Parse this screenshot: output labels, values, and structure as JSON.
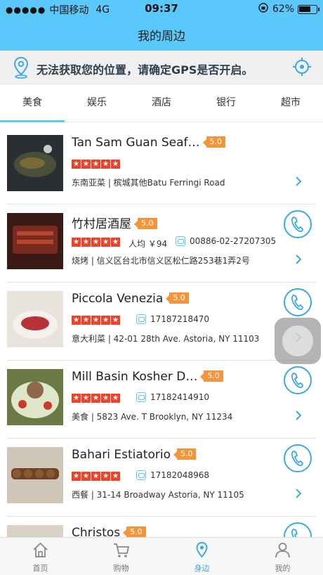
{
  "status": {
    "carrier": "中国移动",
    "network": "4G",
    "time": "09:37",
    "battery": "62%"
  },
  "nav": {
    "title": "我的周边"
  },
  "gps_banner": {
    "message": "无法获取您的位置，请确定GPS是否开启。"
  },
  "categories": [
    {
      "label": "美食",
      "active": true
    },
    {
      "label": "娱乐"
    },
    {
      "label": "酒店"
    },
    {
      "label": "银行"
    },
    {
      "label": "超市"
    }
  ],
  "places": [
    {
      "name": "Tan Sam Guan Seaf…",
      "rating": "5.0",
      "avg_price": "",
      "phone": "",
      "address": "东南亚菜 | 槟城其他Batu Ferringi Road"
    },
    {
      "name": "竹村居酒屋",
      "rating": "5.0",
      "avg_price": "人均 ￥94",
      "phone": "00886-02-27207305",
      "address": "烧烤 | 信义区台北市信义区松仁路253巷1弄2号"
    },
    {
      "name": "Piccola Venezia",
      "rating": "5.0",
      "avg_price": "",
      "phone": "17187218470",
      "address": "意大利菜 | 42-01 28th Ave. Astoria, NY 11103"
    },
    {
      "name": "Mill Basin Kosher D…",
      "rating": "5.0",
      "avg_price": "",
      "phone": "17182414910",
      "address": "美食 | 5823 Ave. T Brooklyn, NY 11234"
    },
    {
      "name": "Bahari Estiatorio",
      "rating": "5.0",
      "avg_price": "",
      "phone": "17182048968",
      "address": "西餐 | 31-14 Broadway Astoria, NY 11105"
    },
    {
      "name": "Christos",
      "rating": "5.0",
      "avg_price": "",
      "phone": "",
      "address": ""
    }
  ],
  "tabbar": [
    {
      "label": "首页",
      "icon": "home-icon"
    },
    {
      "label": "购物",
      "icon": "cart-icon"
    },
    {
      "label": "身边",
      "icon": "location-icon",
      "active": true
    },
    {
      "label": "我的",
      "icon": "person-icon"
    }
  ],
  "colors": {
    "accent": "#5ac8fa",
    "rating_badge": "#f5953a",
    "stars": "#e8452c",
    "icon_blue": "#39a9e3"
  }
}
